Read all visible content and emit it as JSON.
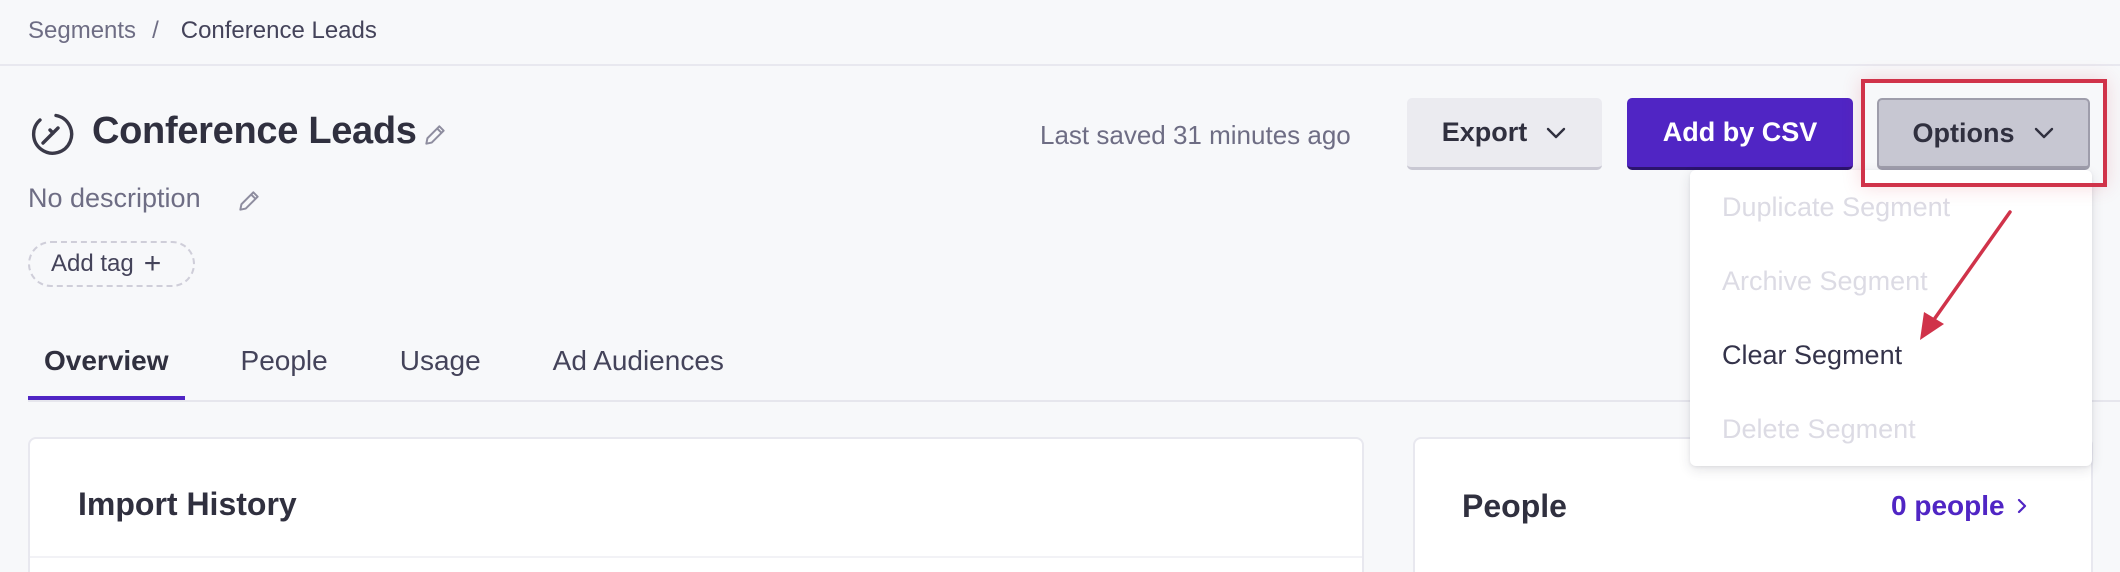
{
  "breadcrumb": {
    "parent": "Segments",
    "separator": "/",
    "current": "Conference Leads"
  },
  "header": {
    "icon": "segment-wrench-icon",
    "title": "Conference Leads",
    "description": "No description",
    "add_tag_label": "Add tag",
    "last_saved": "Last saved 31 minutes ago"
  },
  "toolbar": {
    "export_label": "Export",
    "add_csv_label": "Add by CSV",
    "options_label": "Options"
  },
  "options_menu": {
    "items": [
      {
        "label": "Duplicate Segment",
        "enabled": false
      },
      {
        "label": "Archive Segment",
        "enabled": false
      },
      {
        "label": "Clear Segment",
        "enabled": true
      },
      {
        "label": "Delete Segment",
        "enabled": false
      }
    ]
  },
  "tabs": [
    {
      "label": "Overview",
      "active": true
    },
    {
      "label": "People",
      "active": false
    },
    {
      "label": "Usage",
      "active": false
    },
    {
      "label": "Ad Audiences",
      "active": false
    }
  ],
  "cards": {
    "import_history": {
      "title": "Import History"
    },
    "people": {
      "title": "People",
      "link_label": "0 people"
    }
  },
  "colors": {
    "accent": "#5025c4",
    "annotation": "#d0334a",
    "background": "#f7f8fa"
  }
}
